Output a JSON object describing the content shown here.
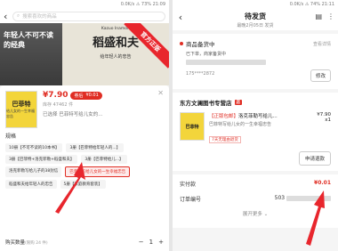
{
  "left": {
    "status": "0.0K/s ⚠ 73% 21:09",
    "search_placeholder": "搜索喜欢的商品",
    "banner": {
      "left_text": "年轻人不可不读的经典",
      "en": "Kazuo Inamori",
      "title": "稻盛和夫",
      "subtitle": "给年轻人的忠告",
      "ribbon": "官方正版"
    },
    "product": {
      "thumb_title": "巴菲特",
      "thumb_sub": "给儿女的一生幸福忠告",
      "price": "¥7.90",
      "badge_label": "券后",
      "badge_value": "¥0.01",
      "stock": "库存 47462 件",
      "selected": "已选择 巴菲特写给儿女的..."
    },
    "spec_label": "规格",
    "options": [
      "10册【不可不读的10本书】",
      "3册【巴菲特给年轻人的...】",
      "3册【巴菲特+洛克菲勒+稻盛和夫】",
      "3册【巴菲特给儿...】",
      "洛克菲勒写给儿子的38封信",
      "巴菲特写给儿女的一生幸福忠告",
      "稻盛和夫给年轻人的忠告",
      "5册【家庭教育套装】"
    ],
    "selected_option_index": 5,
    "qty_label": "购买数量",
    "qty_hint": "(限购 24 件)",
    "qty_value": "1"
  },
  "right": {
    "status": "0.0K/s ⚠ 74% 21:11",
    "title": "待发货",
    "subtitle": "最晚2月05日 发货",
    "addr": {
      "title": "商品备货中",
      "view_detail": "查看详情",
      "line1": "已下单，商家备货中",
      "phone": "175****2872",
      "modify": "修改"
    },
    "store": {
      "name": "东方文澜图书专营店",
      "tag": "店",
      "item_tag": "【正版包邮】",
      "item_name": "洛克菲勒写给儿...",
      "item_sub": "巴菲特写给儿女的一生幸福忠告",
      "return_tag": "7天无理由退货",
      "price": "¥7.90",
      "qty": "x1",
      "refund": "申请退款"
    },
    "pay": {
      "label": "实付款",
      "value": "¥0.01",
      "order_label": "订单编号",
      "order_value": "503",
      "more": "展开更多"
    }
  }
}
